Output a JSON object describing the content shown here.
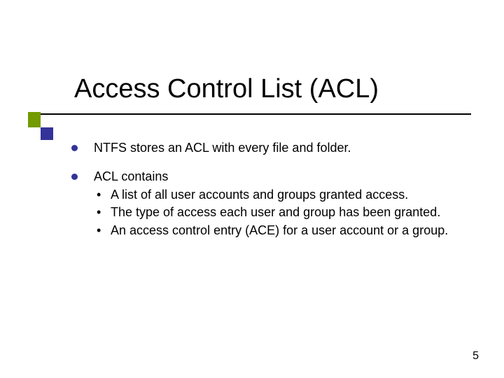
{
  "title": "Access Control List (ACL)",
  "bullets": {
    "b0": {
      "text": "NTFS stores an ACL with every file and folder."
    },
    "b1": {
      "text": "ACL contains",
      "sub": {
        "s0": "A list of all user accounts and groups granted access.",
        "s1": "The type of access each user and group has been granted.",
        "s2": "An access control entry (ACE) for a user account or a group."
      }
    }
  },
  "page_number": "5"
}
